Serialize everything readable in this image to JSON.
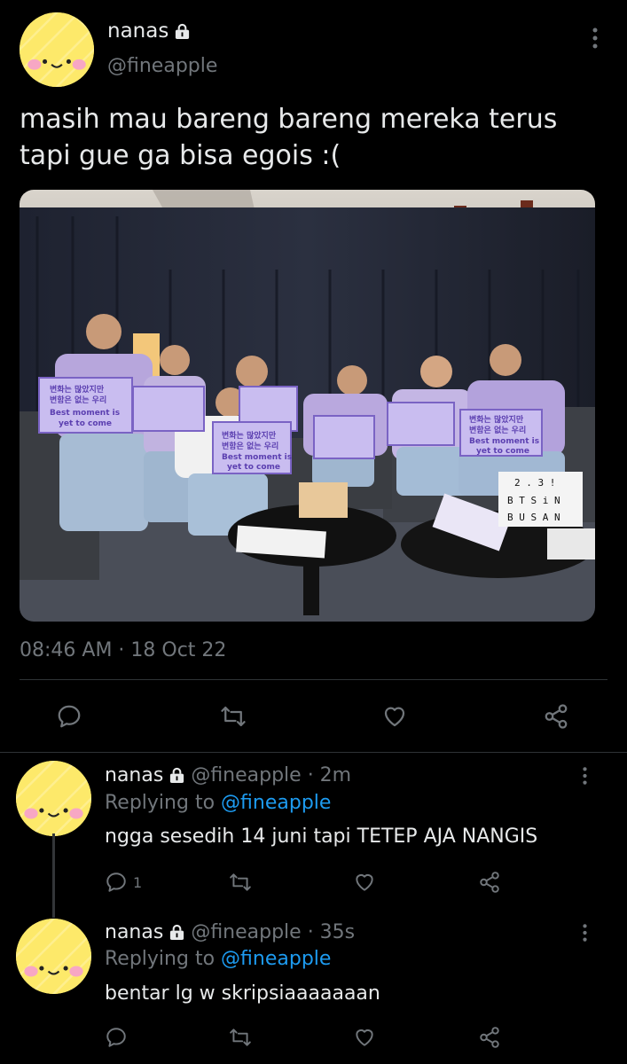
{
  "main_tweet": {
    "display_name": "nanas",
    "handle": "@fineapple",
    "text_line1": "masih mau bareng bareng mereka terus",
    "text_line2": "tapi gue ga bisa egois :(",
    "timestamp": "08:46 AM · 18 Oct 22",
    "media": {
      "sign_line1": "변화는 많았지만",
      "sign_line2": "변함은 없는 우리",
      "sign_line3": "Best moment is",
      "sign_line4": "yet to come",
      "lightbox_line1": "2 . 3 !",
      "lightbox_line2": "B T S i N",
      "lightbox_line3": "B U S A N"
    }
  },
  "replies": [
    {
      "display_name": "nanas",
      "handle_time": "@fineapple · 2m",
      "replying_prefix": "Replying to",
      "replying_handle": "@fineapple",
      "text": "ngga sesedih 14 juni tapi TETEP AJA NANGIS",
      "reply_count": "1"
    },
    {
      "display_name": "nanas",
      "handle_time": "@fineapple · 35s",
      "replying_prefix": "Replying to",
      "replying_handle": "@fineapple",
      "text": "bentar lg w skripsiaaaaaaan"
    }
  ],
  "icons": {
    "reply": "reply-icon",
    "retweet": "retweet-icon",
    "like": "heart-icon",
    "share": "share-icon",
    "lock": "lock-icon",
    "more": "more-vertical-icon"
  },
  "colors": {
    "background": "#000000",
    "text": "#e7e9ea",
    "muted": "#71767b",
    "link": "#1d9bf0",
    "avatar": "#fde96a"
  }
}
